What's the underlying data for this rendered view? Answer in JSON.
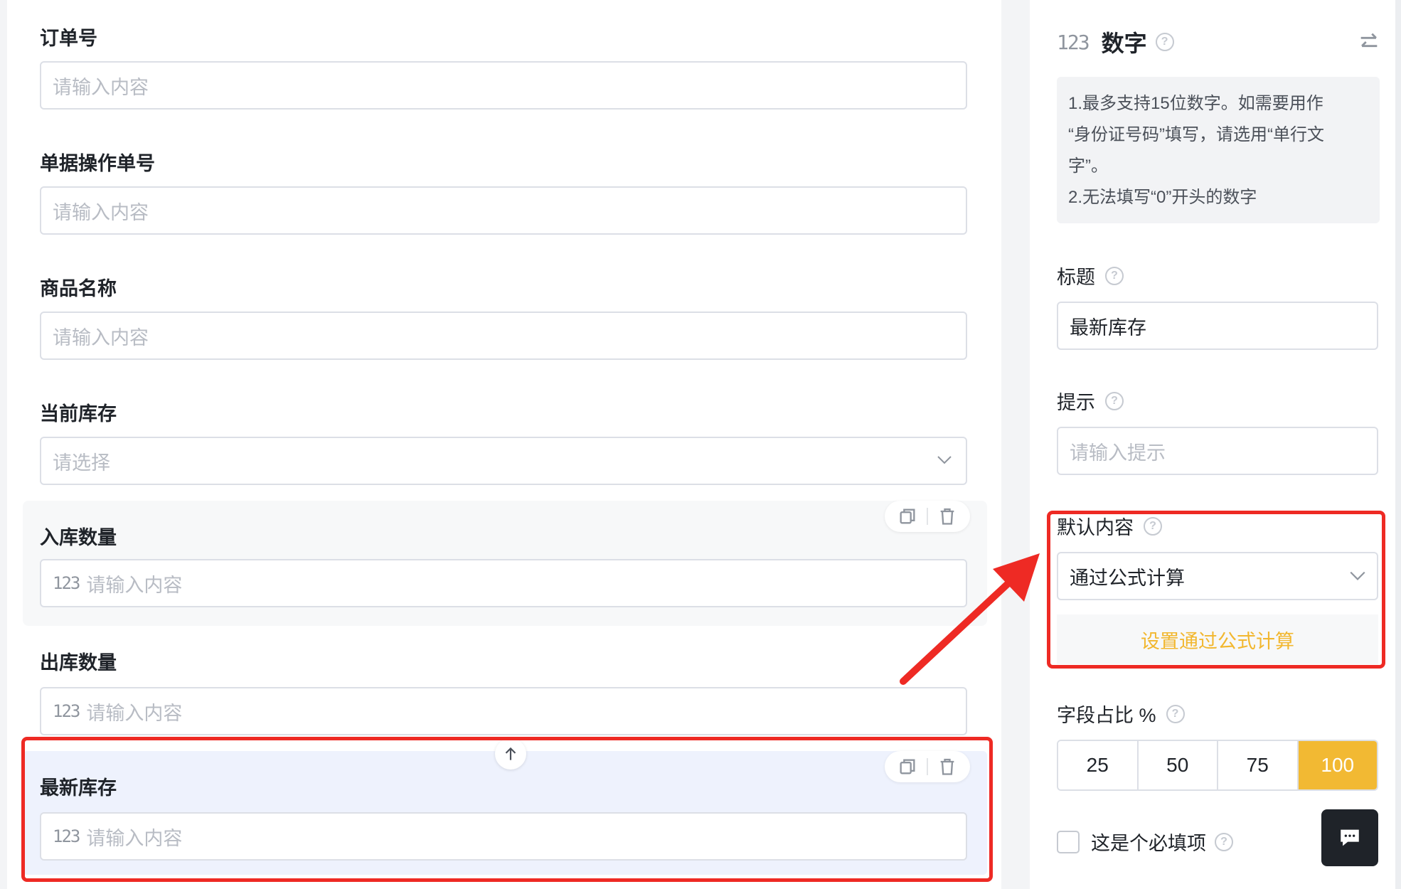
{
  "form": {
    "fields": [
      {
        "label": "订单号",
        "placeholder": "请输入内容",
        "type": "text"
      },
      {
        "label": "单据操作单号",
        "placeholder": "请输入内容",
        "type": "text"
      },
      {
        "label": "商品名称",
        "placeholder": "请输入内容",
        "type": "text"
      },
      {
        "label": "当前库存",
        "placeholder": "请选择",
        "type": "select"
      },
      {
        "label": "入库数量",
        "placeholder": "请输入内容",
        "type": "number"
      },
      {
        "label": "出库数量",
        "placeholder": "请输入内容",
        "type": "number"
      },
      {
        "label": "最新库存",
        "placeholder": "请输入内容",
        "type": "number"
      }
    ],
    "number_icon": "123-icon"
  },
  "panel": {
    "type_title": "数字",
    "type_icon": "123",
    "description": [
      "1.最多支持15位数字。如需要用作",
      "“身份证号码”填写，请选用“单行文",
      "字”。",
      "2.无法填写“0”开头的数字"
    ],
    "title_label": "标题",
    "title_value": "最新库存",
    "hint_label": "提示",
    "hint_placeholder": "请输入提示",
    "default_label": "默认内容",
    "default_value": "通过公式计算",
    "formula_button": "设置通过公式计算",
    "width_label": "字段占比 %",
    "width_options": [
      "25",
      "50",
      "75",
      "100"
    ],
    "width_selected": "100",
    "required_label": "这是个必填项"
  },
  "colors": {
    "accent": "#f2b933",
    "annotation": "#ee2a24",
    "selected_bg": "#eef2fd"
  }
}
